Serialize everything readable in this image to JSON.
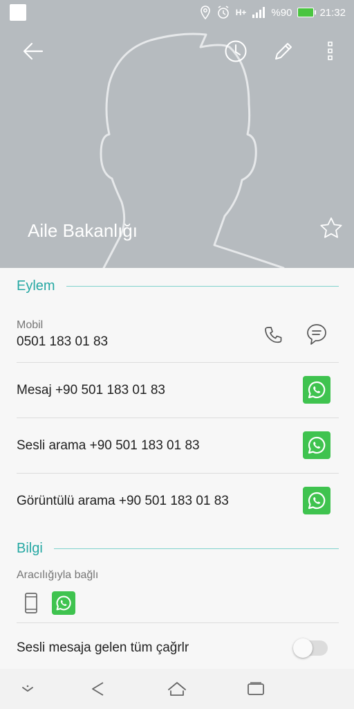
{
  "status_bar": {
    "battery": "%90",
    "time": "21:32",
    "network": "H+"
  },
  "header": {
    "contact_name": "Aile Bakanlığı",
    "background_color": "#b6bbbf"
  },
  "actions_section": {
    "title": "Eylem",
    "mobile_label": "Mobil",
    "mobile_number": "0501 183 01 83",
    "rows": [
      {
        "text": "Mesaj +90 501 183 01 83"
      },
      {
        "text": "Sesli arama +90 501 183 01 83"
      },
      {
        "text": "Görüntülü arama +90 501 183 01 83"
      }
    ]
  },
  "info_section": {
    "title": "Bilgi",
    "connected_via_label": "Aracılığıyla bağlı",
    "voicemail_label": "Sesli mesaja gelen tüm çağrlr",
    "voicemail_enabled": false
  },
  "colors": {
    "accent": "#26a8a3",
    "whatsapp": "#3fc34f"
  },
  "icons": [
    "back-arrow-icon",
    "history-icon",
    "edit-icon",
    "more-icon",
    "star-icon",
    "phone-icon",
    "message-icon",
    "whatsapp-icon",
    "mobile-device-icon"
  ]
}
